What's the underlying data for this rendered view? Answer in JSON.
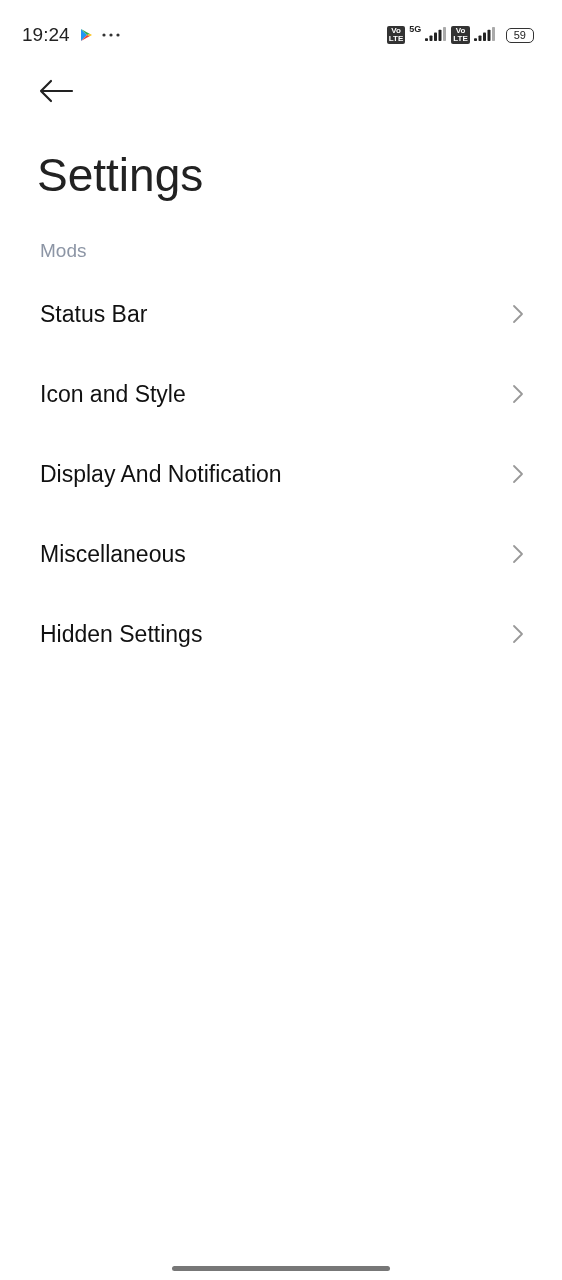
{
  "status_bar": {
    "time": "19:24",
    "network": "5G",
    "battery": "59",
    "volte_badges": [
      {
        "lines": [
          "Vo",
          "LTE"
        ]
      },
      {
        "lines": [
          "Vo",
          "LTE"
        ]
      }
    ]
  },
  "title": "Settings",
  "section": {
    "header": "Mods",
    "items": [
      {
        "label": "Status Bar"
      },
      {
        "label": "Icon and Style"
      },
      {
        "label": "Display And Notification"
      },
      {
        "label": "Miscellaneous"
      },
      {
        "label": "Hidden Settings"
      }
    ]
  }
}
